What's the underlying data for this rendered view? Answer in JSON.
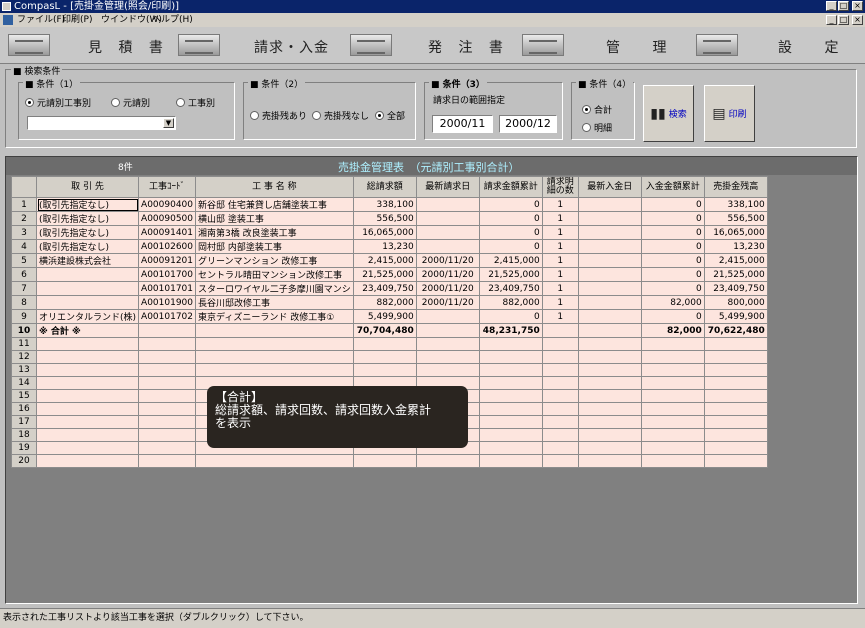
{
  "window": {
    "title": "CompasL - [売掛金管理(照会/印刷)]"
  },
  "menu": [
    "ファイル(F)",
    "印刷(P)",
    "ウインドウ(W)",
    "ヘルプ(H)"
  ],
  "nav": [
    "見 積 書",
    "請求・入金",
    "発 注 書",
    "管 理",
    "設 定"
  ],
  "search": {
    "title": "検索条件",
    "cond1": {
      "title": "条件（1）",
      "opt1": "元請別工事別",
      "opt2": "元請別",
      "opt3": "工事別",
      "selected": ""
    },
    "cond2": {
      "title": "条件（2）",
      "opt1": "売掛残あり",
      "opt2": "売掛残なし",
      "opt3": "全部"
    },
    "cond3": {
      "title": "条件（3）",
      "label": "請求日の範囲指定",
      "from": "2000/11",
      "to": "2000/12"
    },
    "cond4": {
      "title": "条件（4）",
      "opt1": "合計",
      "opt2": "明細"
    },
    "search_btn": "検索",
    "print_btn": "印刷"
  },
  "grid": {
    "count": "8件",
    "title": "売掛金管理表　（元請別工事別合計）",
    "columns": [
      "取 引 先",
      "工事ｺｰﾄﾞ",
      "工 事 名 称",
      "総請求額",
      "最新請求日",
      "請求金額累計",
      "請求明細の数",
      "最新入金日",
      "入金金額累計",
      "売掛金残高"
    ],
    "rows": [
      [
        "1",
        "(取引先指定なし)",
        "A00090400",
        "新谷邸 住宅兼貸し店舗塗装工事",
        "338,100",
        "",
        "0",
        "1",
        "",
        "0",
        "338,100"
      ],
      [
        "2",
        "(取引先指定なし)",
        "A00090500",
        "横山邸 塗装工事",
        "556,500",
        "",
        "0",
        "1",
        "",
        "0",
        "556,500"
      ],
      [
        "3",
        "(取引先指定なし)",
        "A00091401",
        "湘南第3橋 改良塗装工事",
        "16,065,000",
        "",
        "0",
        "1",
        "",
        "0",
        "16,065,000"
      ],
      [
        "4",
        "(取引先指定なし)",
        "A00102600",
        "岡村邸 内部塗装工事",
        "13,230",
        "",
        "0",
        "1",
        "",
        "0",
        "13,230"
      ],
      [
        "5",
        "横浜建設株式会社",
        "A00091201",
        "グリーンマンション 改修工事",
        "2,415,000",
        "2000/11/20",
        "2,415,000",
        "1",
        "",
        "0",
        "2,415,000"
      ],
      [
        "6",
        "",
        "A00101700",
        "セントラル晴田マンション改修工事",
        "21,525,000",
        "2000/11/20",
        "21,525,000",
        "1",
        "",
        "0",
        "21,525,000"
      ],
      [
        "7",
        "",
        "A00101701",
        "スターロワイヤル二子多摩川園マンシ",
        "23,409,750",
        "2000/11/20",
        "23,409,750",
        "1",
        "",
        "0",
        "23,409,750"
      ],
      [
        "8",
        "",
        "A00101900",
        "長谷川邸改修工事",
        "882,000",
        "2000/11/20",
        "882,000",
        "1",
        "",
        "82,000",
        "800,000"
      ],
      [
        "9",
        "オリエンタルランド(株)",
        "A00101702",
        "東京ディズニーランド 改修工事①",
        "5,499,900",
        "",
        "0",
        "1",
        "",
        "0",
        "5,499,900"
      ],
      [
        "10",
        "※ 合計 ※",
        "",
        "",
        "70,704,480",
        "",
        "48,231,750",
        "",
        "",
        "82,000",
        "70,622,480"
      ]
    ],
    "empty_rows": [
      "11",
      "12",
      "13",
      "14",
      "15",
      "16",
      "17",
      "18",
      "19",
      "20"
    ]
  },
  "tooltip": {
    "line1": "【合計】",
    "line2": "総請求額、請求回数、請求回数入金累計",
    "line3": "を表示"
  },
  "status": "表示された工事リストより該当工事を選択（ダブルクリック）して下さい。"
}
